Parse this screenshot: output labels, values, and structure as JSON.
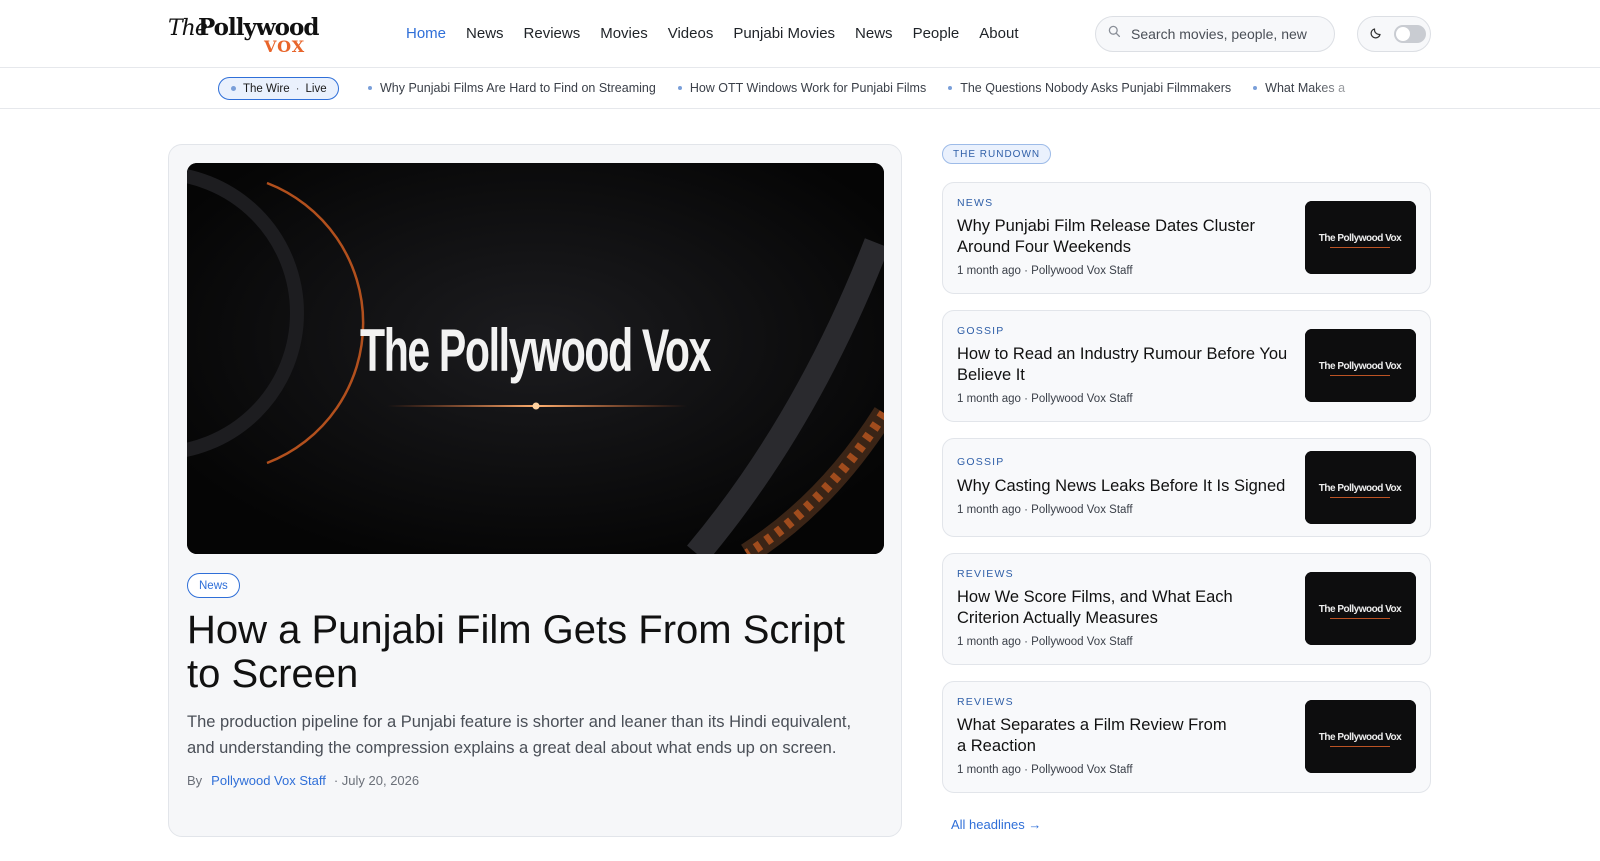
{
  "brand": {
    "logo_text": "The Pollywood Vox",
    "logo_the": "The",
    "logo_main": "Pollywood",
    "logo_vox": "VOX",
    "accent": "#e8652b",
    "link_color": "#2f6fd8"
  },
  "nav": {
    "items": [
      "Home",
      "News",
      "Reviews",
      "Movies",
      "Videos",
      "Punjabi Movies",
      "News",
      "People",
      "About"
    ],
    "active": "Home"
  },
  "search": {
    "placeholder": "Search movies, people, new"
  },
  "theme_toggle": {
    "icon": "moon-icon",
    "state": "off"
  },
  "ticker": {
    "badge_label": "The Wire",
    "badge_status": "Live",
    "items": [
      "Why Punjabi Films Are Hard to Find on Streaming",
      "How OTT Windows Work for Punjabi Films",
      "The Questions Nobody Asks Punjabi Filmmakers",
      "What Makes a"
    ]
  },
  "feature": {
    "image_text": "The Pollywood Vox",
    "tag": "News",
    "headline": "How a Punjabi Film Gets From Script to Screen",
    "dek": "The production pipeline for a Punjabi feature is shorter and leaner than its Hindi equivalent, and understanding the compression explains a great deal about what ends up on screen.",
    "by_label": "By",
    "author": "Pollywood Vox Staff",
    "date": "· July 20, 2026"
  },
  "rundown": {
    "label": "THE RUNDOWN",
    "items": [
      {
        "category": "NEWS",
        "title": "Why Punjabi Film Release Dates Cluster Around Four Weekends",
        "meta": "1 month ago · Pollywood Vox Staff",
        "thumb_text": "The Pollywood Vox"
      },
      {
        "category": "GOSSIP",
        "title": "How to Read an Industry Rumour Before You Believe It",
        "meta": "1 month ago · Pollywood Vox Staff",
        "thumb_text": "The Pollywood Vox"
      },
      {
        "category": "GOSSIP",
        "title": "Why Casting News Leaks Before It Is Signed",
        "meta": "1 month ago · Pollywood Vox Staff",
        "thumb_text": "The Pollywood Vox"
      },
      {
        "category": "REVIEWS",
        "title": "How We Score Films, and What Each Criterion Actually Measures",
        "meta": "1 month ago · Pollywood Vox Staff",
        "thumb_text": "The Pollywood Vox"
      },
      {
        "category": "REVIEWS",
        "title": "What Separates a Film Review From a Reaction",
        "meta": "1 month ago · Pollywood Vox Staff",
        "thumb_text": "The Pollywood Vox"
      }
    ],
    "all_link": "All headlines →"
  }
}
